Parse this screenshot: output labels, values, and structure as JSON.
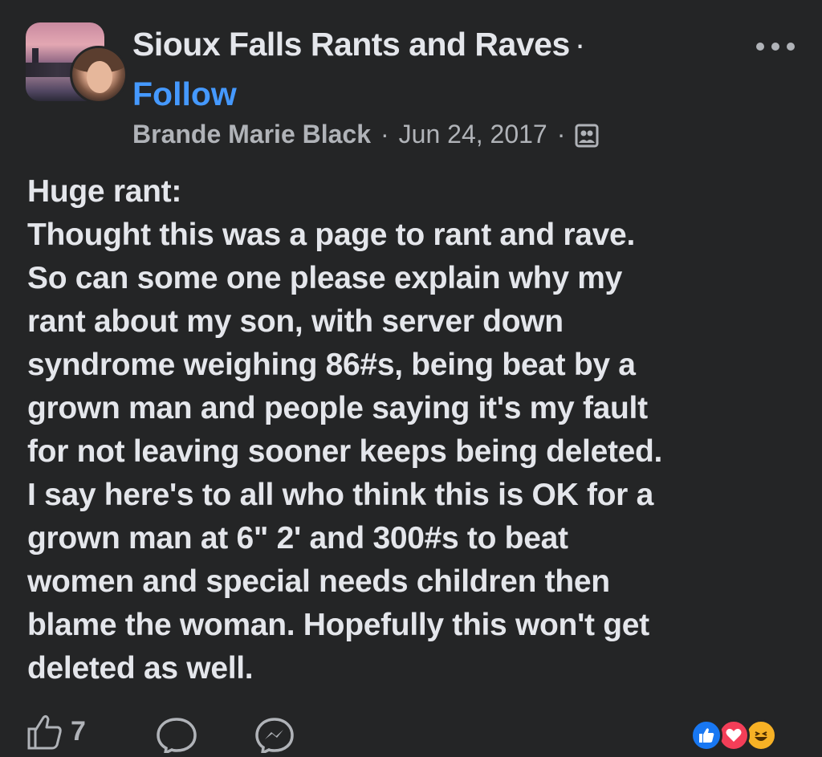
{
  "post": {
    "group_name": "Sioux Falls Rants and Raves",
    "title_separator": "·",
    "follow_label": "Follow",
    "author": "Brande Marie Black",
    "meta_separator": "·",
    "date": "Jun 24, 2017",
    "privacy_icon": "group-members-icon",
    "body": "Huge rant:\nThought this was a page to rant and rave.\nSo can some one please explain why my\nrant about my son, with server down\nsyndrome weighing 86#s, being beat by a\ngrown man and people saying it's my fault\nfor not leaving sooner keeps being deleted.\nI say here's to all who think this is OK for a\ngrown man at 6\" 2' and 300#s to beat\nwomen and special needs children then\nblame the woman. Hopefully this won't get\ndeleted as well."
  },
  "actions": {
    "like_count": "7",
    "reactions": [
      "like-reaction-icon",
      "love-reaction-icon",
      "haha-reaction-icon"
    ]
  },
  "colors": {
    "background": "#242526",
    "text": "#e4e6eb",
    "secondary_text": "#b0b3b8",
    "follow": "#4599ff",
    "like": "#1877f2",
    "love": "#f33e58",
    "haha": "#f7b125"
  }
}
